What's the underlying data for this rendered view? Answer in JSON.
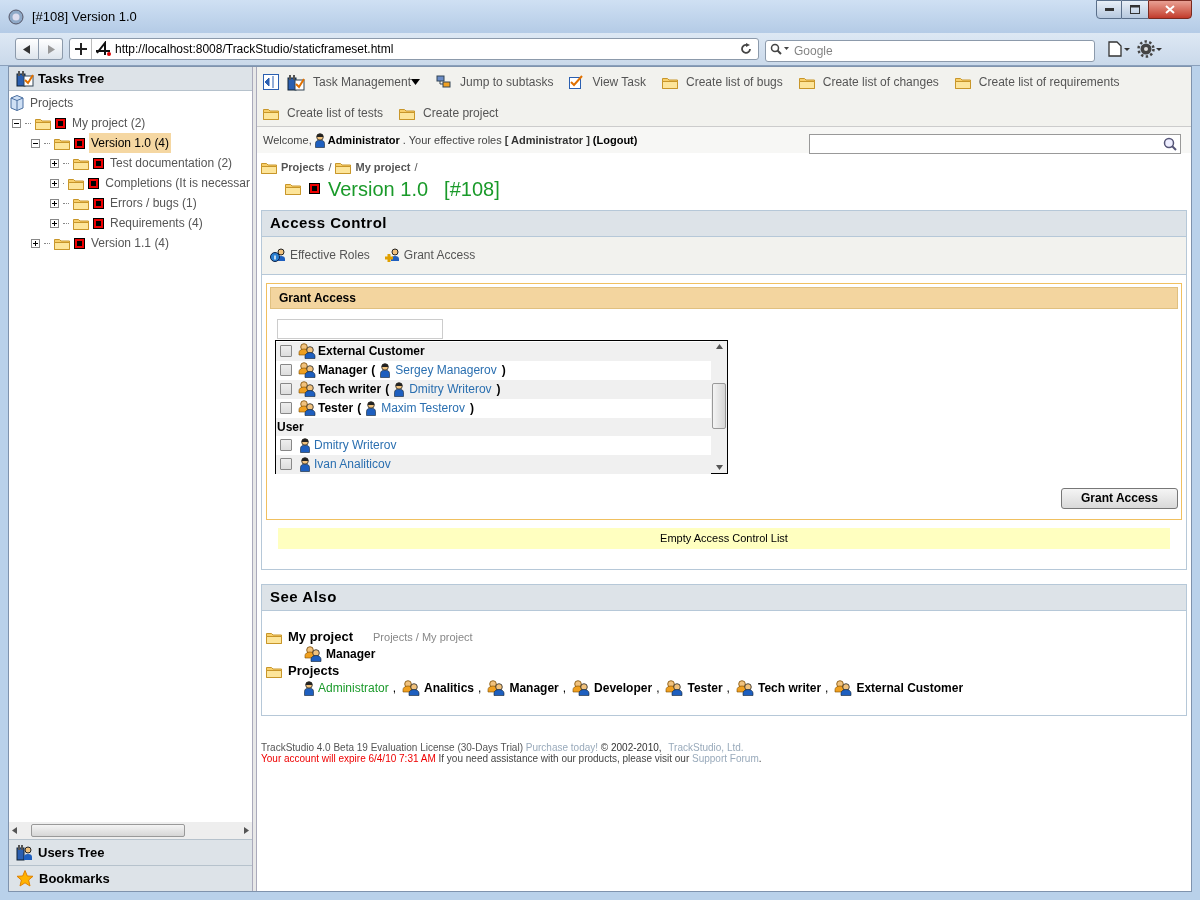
{
  "window": {
    "title": "[#108] Version 1.0"
  },
  "browser": {
    "url": "http://localhost:8008/TrackStudio/staticframeset.html",
    "search_placeholder": "Google"
  },
  "sidebar": {
    "title": "Tasks Tree",
    "tree": [
      {
        "label": "Projects",
        "kind": "root",
        "selected": false,
        "children": [
          {
            "label": "My project (2)",
            "kind": "folder",
            "expanded": true,
            "selected": false,
            "children": [
              {
                "label": "Version 1.0 (4)",
                "kind": "folder",
                "expanded": true,
                "selected": true,
                "children": [
                  {
                    "label": "Test documentation (2)",
                    "kind": "folder",
                    "expanded": false,
                    "selected": false
                  },
                  {
                    "label": "Completions (It is necessar",
                    "kind": "folder",
                    "expanded": false,
                    "selected": false
                  },
                  {
                    "label": "Errors / bugs (1)",
                    "kind": "folder",
                    "expanded": false,
                    "selected": false
                  },
                  {
                    "label": "Requirements (4)",
                    "kind": "folder",
                    "expanded": false,
                    "selected": false
                  }
                ]
              },
              {
                "label": "Version 1.1 (4)",
                "kind": "folder",
                "expanded": false,
                "selected": false
              }
            ]
          }
        ]
      }
    ],
    "panels": [
      "Users Tree",
      "Bookmarks"
    ]
  },
  "toolbar": {
    "items": [
      {
        "label": "Task Management",
        "kind": "menu"
      },
      {
        "label": "Jump to subtasks",
        "kind": "subtasks"
      },
      {
        "label": "View Task",
        "kind": "view"
      },
      {
        "label": "Create list of bugs",
        "kind": "create"
      },
      {
        "label": "Create list of changes",
        "kind": "create"
      },
      {
        "label": "Create list of requirements",
        "kind": "create"
      },
      {
        "label": "Create list of tests",
        "kind": "create"
      },
      {
        "label": "Create project",
        "kind": "create"
      }
    ]
  },
  "welcome": {
    "greeting": "Welcome,",
    "user": "Administrator",
    "roles_label": ". Your effective roles",
    "roles": "[ Administrator ]",
    "logout": "(Logout)"
  },
  "breadcrumb": {
    "items": [
      "Projects",
      "My project"
    ],
    "separator": "/"
  },
  "task": {
    "name": "Version 1.0",
    "number": "[#108]"
  },
  "access_control": {
    "title": "Access Control",
    "tabs": [
      {
        "label": "Effective Roles",
        "kind": "roles"
      },
      {
        "label": "Grant Access",
        "kind": "grant"
      }
    ],
    "grant_panel": {
      "title": "Grant Access",
      "list": [
        {
          "kind": "role",
          "label": "External Customer",
          "checked": false
        },
        {
          "kind": "role",
          "label": "Manager",
          "user": "Sergey Managerov",
          "checked": false
        },
        {
          "kind": "role",
          "label": "Tech writer",
          "user": "Dmitry Writerov",
          "checked": false
        },
        {
          "kind": "role",
          "label": "Tester",
          "user": "Maxim Testerov",
          "checked": false
        },
        {
          "kind": "header",
          "label": "User"
        },
        {
          "kind": "user",
          "label": "Dmitry Writerov",
          "checked": false
        },
        {
          "kind": "user",
          "label": "Ivan Analiticov",
          "checked": false
        }
      ],
      "bracket_open": "(",
      "bracket_close": ")",
      "button": "Grant Access"
    },
    "empty_message": "Empty Access Control List"
  },
  "see_also": {
    "title": "See Also",
    "separator": ",",
    "groups": [
      {
        "name": "My project",
        "path": "Projects / My project",
        "members": [
          {
            "kind": "role",
            "name": "Manager"
          }
        ]
      },
      {
        "name": "Projects",
        "members": [
          {
            "kind": "user",
            "name": "Administrator"
          },
          {
            "kind": "role",
            "name": "Analitics"
          },
          {
            "kind": "role",
            "name": "Manager"
          },
          {
            "kind": "role",
            "name": "Developer"
          },
          {
            "kind": "role",
            "name": "Tester"
          },
          {
            "kind": "role",
            "name": "Tech writer"
          },
          {
            "kind": "role",
            "name": "External Customer"
          }
        ]
      }
    ]
  },
  "footer": {
    "license": "TrackStudio 4.0 Beta 19 Evaluation License (30-Days Trial)",
    "purchase": "Purchase today!",
    "copyright": "© 2002-2010,",
    "company": "TrackStudio, Ltd.",
    "expiry": "Your account will expire 6/4/10 7:31 AM",
    "assistance": "If you need assistance with our products, please visit our",
    "forum": "Support Forum",
    "end": "."
  }
}
